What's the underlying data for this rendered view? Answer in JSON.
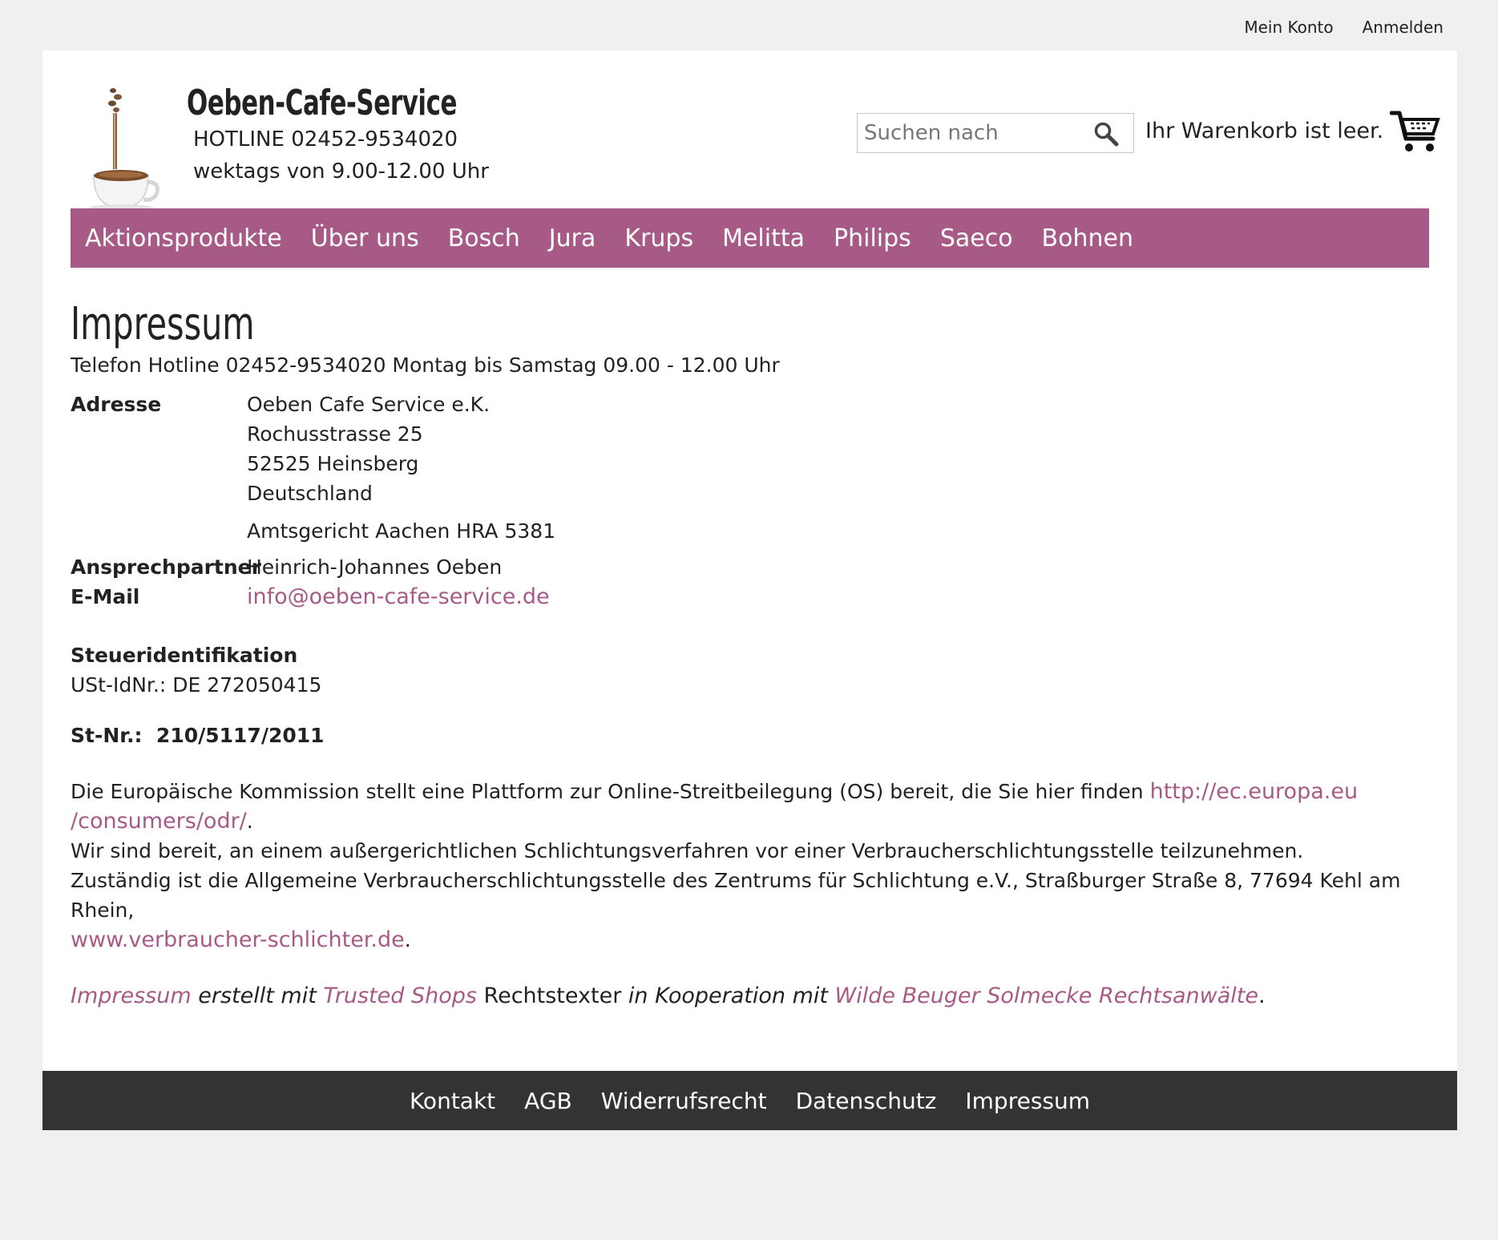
{
  "topbar": {
    "my_account": "Mein Konto",
    "login": "Anmelden"
  },
  "header": {
    "shop_name": "Oeben-Cafe-Service",
    "hotline": "HOTLINE 02452-9534020",
    "hours": "wektags von 9.00-12.00 Uhr",
    "search_placeholder": "Suchen nach",
    "cart_text": "Ihr Warenkorb ist leer."
  },
  "nav": {
    "items": [
      "Aktionsprodukte",
      "Über uns",
      "Bosch",
      "Jura",
      "Krups",
      "Melitta",
      "Philips",
      "Saeco",
      "Bohnen"
    ]
  },
  "content": {
    "title": "Impressum",
    "phone_line": "Telefon Hotline 02452-9534020 Montag bis Samstag 09.00 - 12.00 Uhr",
    "address_label": "Adresse",
    "address_lines": [
      "Oeben Cafe Service e.K.",
      "Rochusstrasse 25",
      "52525 Heinsberg",
      "Deutschland"
    ],
    "court": "Amtsgericht Aachen HRA 5381",
    "contact_label": "Ansprechpartner",
    "contact_value": "Heinrich-Johannes Oeben",
    "email_label": "E-Mail",
    "email_value": "info@oeben-cafe-service.de",
    "tax_heading": "Steueridentifikation",
    "vat_id": "USt-IdNr.: DE 272050415",
    "tax_no": "St-Nr.:  210/5117/2011",
    "os_text": "Die Europäische Kommission stellt eine Plattform zur Online-Streitbeilegung (OS) bereit, die Sie hier finden ",
    "os_link_1": "http://ec.europa.eu",
    "os_link_2": "/consumers/odr/",
    "os_period": ".",
    "willing_text": "Wir sind bereit, an einem außergerichtlichen Schlichtungsverfahren vor einer Verbraucherschlichtungsstelle teilzunehmen.",
    "responsible_text": "Zuständig ist die Allgemeine Verbraucherschlichtungsstelle des Zentrums für Schlichtung e.V., Straßburger Straße 8, 77694 Kehl am Rhein,",
    "schlichter_link": "www.verbraucher-schlichter.de",
    "schlichter_period": ".",
    "credit_link_1": "Impressum",
    "credit_text_1": " erstellt mit ",
    "credit_link_2": "Trusted Shops",
    "credit_text_2": " Rechtstexter",
    "credit_text_3": " in Kooperation mit ",
    "credit_link_3": "Wilde Beuger Solmecke Rechtsanwälte",
    "credit_period": "."
  },
  "footer": {
    "items": [
      "Kontakt",
      "AGB",
      "Widerrufsrecht",
      "Datenschutz",
      "Impressum"
    ]
  },
  "colors": {
    "accent": "#a85a87",
    "footer_bg": "#333333",
    "page_bg": "#f0f0f0"
  },
  "icons": {
    "search": "magnifier-icon",
    "cart": "shopping-cart-icon",
    "logo": "coffee-cup-logo"
  }
}
